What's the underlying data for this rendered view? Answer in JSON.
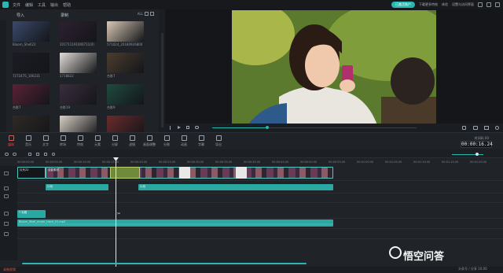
{
  "menubar": {
    "items": [
      "文件",
      "编辑",
      "工具",
      "输出",
      "帮助"
    ],
    "account_button": "已激活账户",
    "download_label": "下载更多特效",
    "feedback_label": "体验",
    "settings_label": "设置与访问界面"
  },
  "media": {
    "dropdown_label": "导入",
    "dropdown2_label": "录制",
    "all_label": "ALL",
    "thumbs": [
      {
        "label": "Bloom_Shell22",
        "color": "#3b4a6b"
      },
      {
        "label": "201711191000711(0)",
        "color": "#2d2030"
      },
      {
        "label": "571024_20180926800",
        "color": "#d9c9b6"
      },
      {
        "label": "7272475_100231",
        "color": "#1c1c24"
      },
      {
        "label": "2718822",
        "color": "#e2ddd7"
      },
      {
        "label": "合影7",
        "color": "#4b3d2e"
      },
      {
        "label": "合影7",
        "color": "#5a2236"
      },
      {
        "label": "合影19",
        "color": "#3a2d3d"
      },
      {
        "label": "合影9",
        "color": "#1f4a3e"
      },
      {
        "label": "合影7",
        "color": "#2e2a24"
      },
      {
        "label": "合影5",
        "color": "#d8cfc4"
      },
      {
        "label": "合影10",
        "color": "#6b2b2b"
      }
    ]
  },
  "preview": {
    "progress": 0.27
  },
  "toolbar": {
    "tools": [
      "媒体",
      "音乐",
      "文字",
      "转场",
      "特效",
      "元素",
      "分屏",
      "滤镜",
      "画面调整",
      "分割",
      "动画",
      "字幕",
      "导出"
    ],
    "timecode_label": "时间码 00",
    "timecode": "00:00:16.24"
  },
  "timeline": {
    "ruler": [
      "00:00:00.00",
      "00:00:05.00",
      "00:00:10.00",
      "00:00:15.00",
      "00:00:20.00",
      "00:00:25.00",
      "00:00:30.00",
      "00:00:35.00",
      "00:00:40.00",
      "00:00:45.00",
      "00:00:50.00",
      "00:00:55.00",
      "00:01:00.00",
      "00:01:05.00",
      "00:01:10.00",
      "00:01:15.00",
      "00:01:20.00"
    ],
    "video_clip1": "片头22",
    "video_clip2": "合影素材",
    "title_clip": "T 标题",
    "audio_label": "Bloom_Shell_music_track_01.mp3",
    "sub_clip1": "片段",
    "sub_clip2": "片段",
    "status_rec": "录制视频"
  },
  "watermark": {
    "text": "悟空问答",
    "sub": "头条号 / 分享 10.00"
  }
}
